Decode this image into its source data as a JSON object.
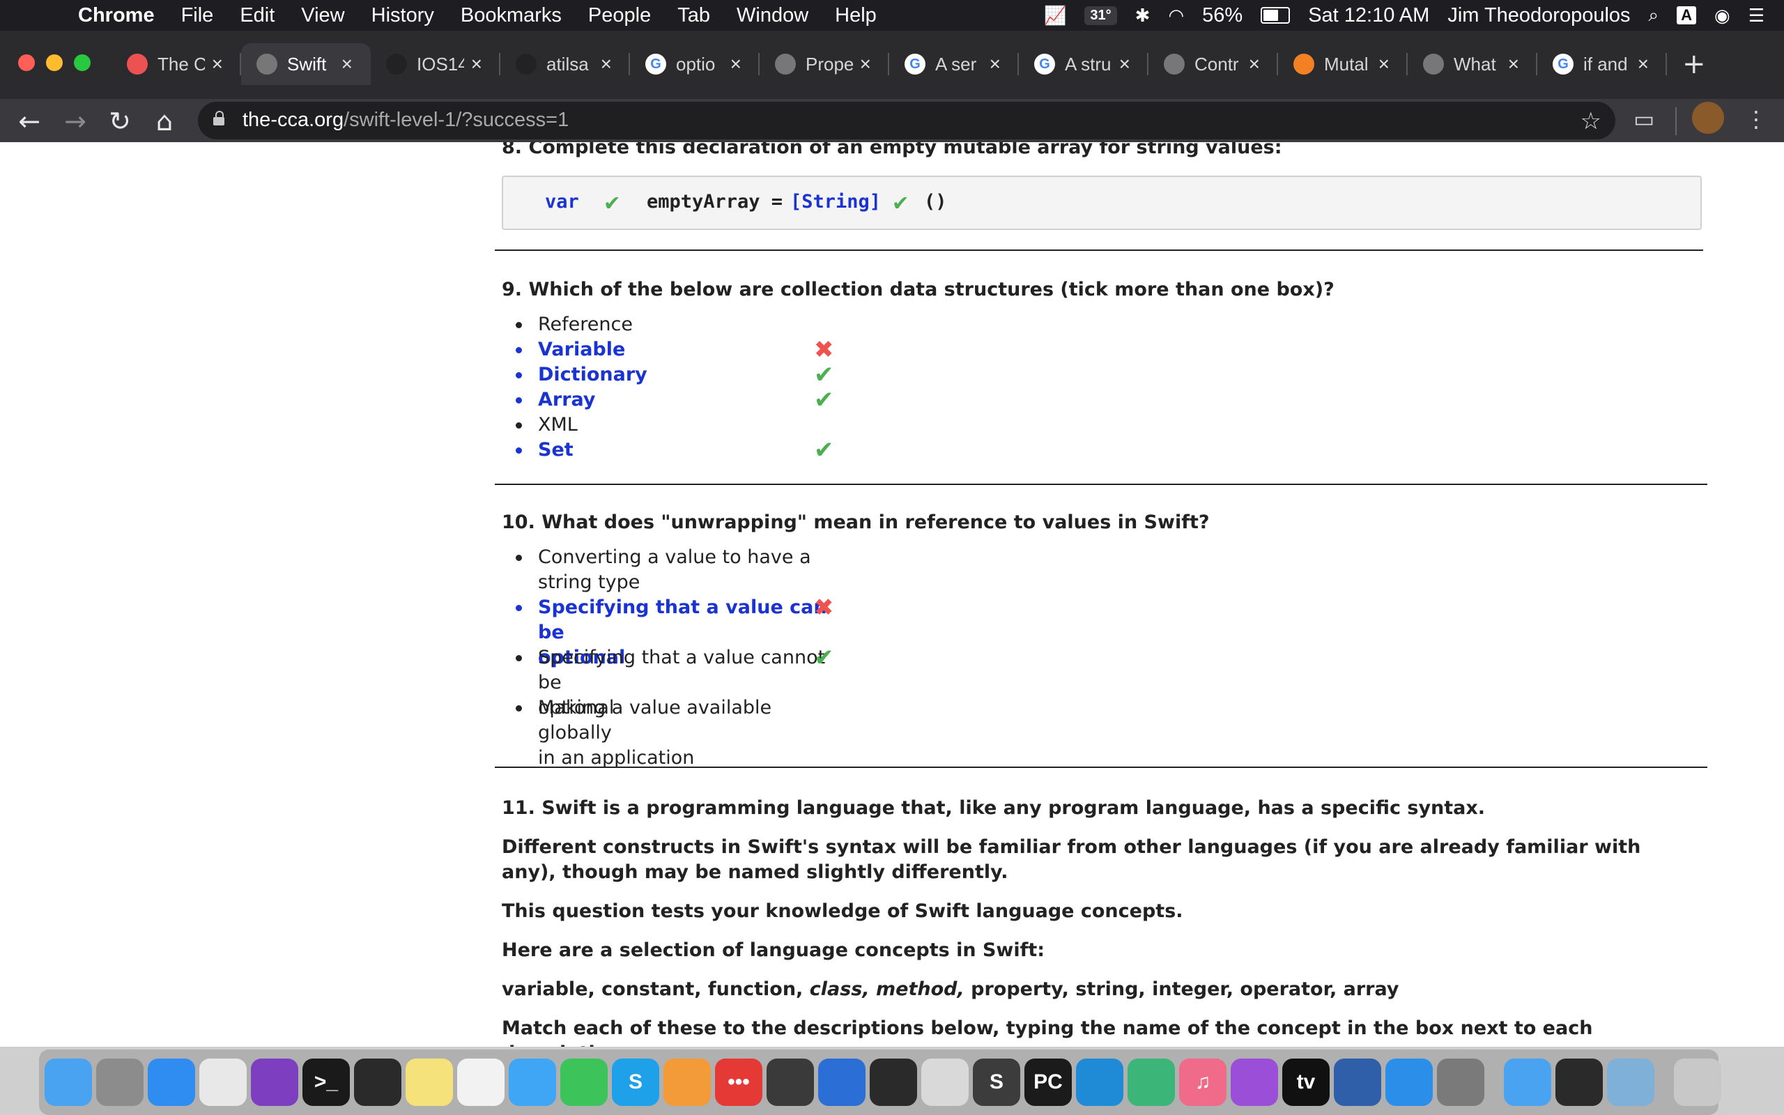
{
  "menubar": {
    "app": "Chrome",
    "menus": [
      "File",
      "Edit",
      "View",
      "History",
      "Bookmarks",
      "People",
      "Tab",
      "Window",
      "Help"
    ],
    "temperature": "31°",
    "battery": "56%",
    "clock": "Sat 12:10 AM",
    "user": "Jim Theodoropoulos",
    "input_source": "A"
  },
  "tabs": [
    {
      "title": "The C",
      "favicon": "udemy-icon",
      "fav_color": "#ec5252"
    },
    {
      "title": "Swift",
      "favicon": "globe-icon",
      "fav_color": "#777777",
      "active": true
    },
    {
      "title": "IOS14",
      "favicon": "github-icon",
      "fav_color": "#222222"
    },
    {
      "title": "atilsa",
      "favicon": "github-icon",
      "fav_color": "#222222"
    },
    {
      "title": "optio",
      "favicon": "google-icon",
      "fav_color": "#ffffff"
    },
    {
      "title": "Prope",
      "favicon": "globe-icon",
      "fav_color": "#777777"
    },
    {
      "title": "A ser",
      "favicon": "google-icon",
      "fav_color": "#ffffff"
    },
    {
      "title": "A stru",
      "favicon": "google-icon",
      "fav_color": "#ffffff"
    },
    {
      "title": "Contr",
      "favicon": "globe-icon",
      "fav_color": "#777777"
    },
    {
      "title": "Mutal",
      "favicon": "stackoverflow-icon",
      "fav_color": "#f48024"
    },
    {
      "title": "What",
      "favicon": "globe-icon",
      "fav_color": "#777777"
    },
    {
      "title": "if and",
      "favicon": "google-icon",
      "fav_color": "#ffffff"
    }
  ],
  "toolbar": {
    "url_host": "the-cca.org",
    "url_path": "/swift-level-1/?success=1"
  },
  "q8": {
    "question": "8. Complete this declaration of an empty mutable array for string values:",
    "code_kw": "var",
    "code_name": "emptyArray =",
    "code_type": "[String]",
    "code_end": "()"
  },
  "q9": {
    "question": "9. Which of the below are collection data structures (tick more than one box)?",
    "options": [
      "Reference",
      "Variable",
      "Dictionary",
      "Array",
      "XML",
      "Set"
    ]
  },
  "q10": {
    "question": "10. What does \"unwrapping\" mean in reference to values in Swift?",
    "options": [
      [
        "Converting a value to have a",
        "string type"
      ],
      [
        "Specifying that a value can be",
        "optional"
      ],
      [
        "Specifying that a value cannot be",
        "optional"
      ],
      [
        "Making a value available globally",
        "in an application"
      ]
    ]
  },
  "q11": {
    "p1": "11. Swift is a programming language that, like any program language, has a specific syntax.",
    "p2": "Different constructs in Swift's syntax will be familiar from other languages (if you are already familiar with any), though may be named slightly differently.",
    "p3": "This question tests your knowledge of Swift language concepts.",
    "p4": "Here are a selection of language concepts in Swift:",
    "p5a": "variable, constant, function,",
    "p5b": "class, method,",
    "p5c": "property, string, integer, operator, array",
    "p6": "Match each of these to the descriptions below, typing the name of the concept in the box next to each description:"
  },
  "dock": [
    {
      "name": "finder-icon",
      "color": "#4aa3f0",
      "glyph": ""
    },
    {
      "name": "launchpad-icon",
      "color": "#8c8c8c",
      "glyph": ""
    },
    {
      "name": "safari-icon",
      "color": "#2f8cf0",
      "glyph": ""
    },
    {
      "name": "chrome-icon",
      "color": "#e8e8e8",
      "glyph": ""
    },
    {
      "name": "tor-browser-icon",
      "color": "#7d3fbf",
      "glyph": ""
    },
    {
      "name": "terminal-icon",
      "color": "#1a1a1a",
      "glyph": ">_"
    },
    {
      "name": "activity-monitor-icon",
      "color": "#2a2a2a",
      "glyph": ""
    },
    {
      "name": "notes-icon",
      "color": "#f6e27a",
      "glyph": ""
    },
    {
      "name": "reminders-icon",
      "color": "#f2f2f2",
      "glyph": ""
    },
    {
      "name": "messages-icon",
      "color": "#3ea6f5",
      "glyph": ""
    },
    {
      "name": "facetime-icon",
      "color": "#3cc45a",
      "glyph": ""
    },
    {
      "name": "skype-icon",
      "color": "#1ea1e8",
      "glyph": "S"
    },
    {
      "name": "home-icon",
      "color": "#f29b38",
      "glyph": ""
    },
    {
      "name": "more-icon",
      "color": "#e53935",
      "glyph": "•••"
    },
    {
      "name": "davinci-icon",
      "color": "#3a3a3a",
      "glyph": ""
    },
    {
      "name": "istat-icon",
      "color": "#2b6fd6",
      "glyph": ""
    },
    {
      "name": "mindnode-icon",
      "color": "#2a2a2a",
      "glyph": ""
    },
    {
      "name": "popcorn-icon",
      "color": "#d9d9d9",
      "glyph": ""
    },
    {
      "name": "sublime-icon",
      "color": "#3c3c3c",
      "glyph": "S"
    },
    {
      "name": "pycharm-icon",
      "color": "#1b1b1b",
      "glyph": "PC"
    },
    {
      "name": "vscode-icon",
      "color": "#1f8ad6",
      "glyph": ""
    },
    {
      "name": "atom-icon",
      "color": "#3bb578",
      "glyph": ""
    },
    {
      "name": "music-icon",
      "color": "#f06a8a",
      "glyph": "♫"
    },
    {
      "name": "podcasts-icon",
      "color": "#9b4fd9",
      "glyph": ""
    },
    {
      "name": "appletv-icon",
      "color": "#111111",
      "glyph": "tv"
    },
    {
      "name": "virtualbox-icon",
      "color": "#2e5fa8",
      "glyph": ""
    },
    {
      "name": "xcode-icon",
      "color": "#2b8ee8",
      "glyph": ""
    },
    {
      "name": "system-preferences-icon",
      "color": "#7a7a7a",
      "glyph": ""
    },
    {
      "name": "xcode-folder-icon",
      "color": "#4aa3f0",
      "glyph": ""
    },
    {
      "name": "quicktime-icon",
      "color": "#2a2a2a",
      "glyph": ""
    },
    {
      "name": "preview-icon",
      "color": "#7fb0d8",
      "glyph": ""
    },
    {
      "name": "trash-icon",
      "color": "#c8c8c8",
      "glyph": ""
    }
  ]
}
